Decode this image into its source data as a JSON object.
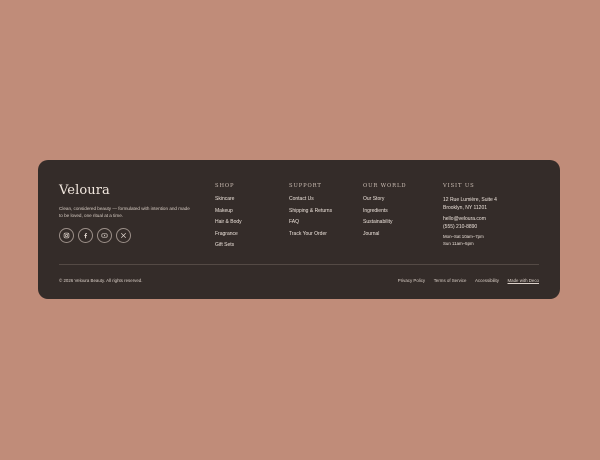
{
  "brand": {
    "logo": "Veloura",
    "tagline": "Clean, considered beauty — formulated with intention and made to be loved, one ritual at a time."
  },
  "socials": [
    {
      "icon": "instagram-icon"
    },
    {
      "icon": "facebook-icon"
    },
    {
      "icon": "youtube-icon"
    },
    {
      "icon": "x-icon"
    }
  ],
  "shop": {
    "heading": "Shop",
    "items": [
      "Skincare",
      "Makeup",
      "Hair & Body",
      "Fragrance",
      "Gift Sets"
    ]
  },
  "support": {
    "heading": "Support",
    "items": [
      "Contact Us",
      "Shipping & Returns",
      "FAQ",
      "Track Your Order"
    ]
  },
  "world": {
    "heading": "Our World",
    "items": [
      "Our Story",
      "Ingredients",
      "Sustainability",
      "Journal"
    ]
  },
  "visit": {
    "heading": "Visit Us",
    "address_line1": "12 Rue Lumière, Suite 4",
    "address_line2": "Brooklyn, NY 11201",
    "email": "hello@veloura.com",
    "phone": "(555) 210-8890",
    "hours_weekday": "Mon–Sat 10am–7pm",
    "hours_sunday": "Sun 11am–5pm"
  },
  "bottom": {
    "copyright": "© 2026 Veloura Beauty. All rights reserved.",
    "privacy": "Privacy Policy",
    "terms": "Terms of Service",
    "accessibility": "Accessibility",
    "made_with": "Made with Deco"
  },
  "colors": {
    "page_bg": "#c08c79",
    "footer_bg": "#342c29"
  }
}
